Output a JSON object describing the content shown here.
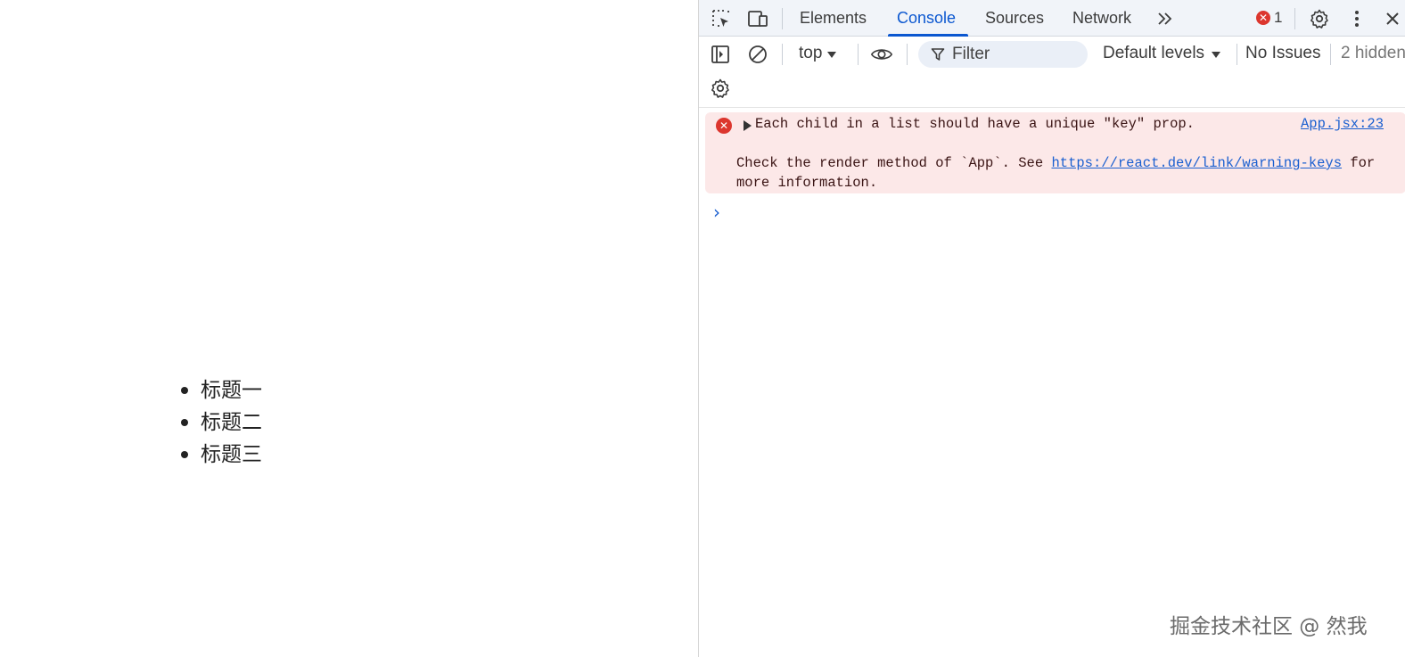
{
  "page": {
    "list_items": [
      "标题一",
      "标题二",
      "标题三"
    ]
  },
  "devtools": {
    "tabs": [
      {
        "label": "Elements"
      },
      {
        "label": "Console"
      },
      {
        "label": "Sources"
      },
      {
        "label": "Network"
      }
    ],
    "active_tab": "Console",
    "error_count": "1",
    "toolbar": {
      "context": "top",
      "filter_placeholder": "Filter",
      "levels": "Default levels",
      "issues": "No Issues",
      "hidden": "2 hidden"
    },
    "console": {
      "error_message": "Each child in a list should have a unique \"key\" prop.",
      "error_source": "App.jsx:23",
      "detail_prefix": "Check the render method of `App`. See ",
      "detail_link": "https://react.dev/link/warning-keys",
      "detail_suffix": " for more information."
    }
  },
  "watermark": "掘金技术社区 @ 然我",
  "colors": {
    "accent": "#0b57d0",
    "error": "#dc362e",
    "error_bg": "#fce8e8",
    "tabbar_bg": "#f1f4f9"
  },
  "icons": [
    "inspect-element-icon",
    "device-toolbar-icon",
    "more-tabs-icon",
    "settings-icon",
    "more-options-icon",
    "close-icon",
    "sidebar-toggle-icon",
    "clear-console-icon",
    "eye-icon",
    "filter-icon",
    "console-settings-icon",
    "error-icon",
    "expand-triangle-icon",
    "prompt-chevron-icon"
  ]
}
